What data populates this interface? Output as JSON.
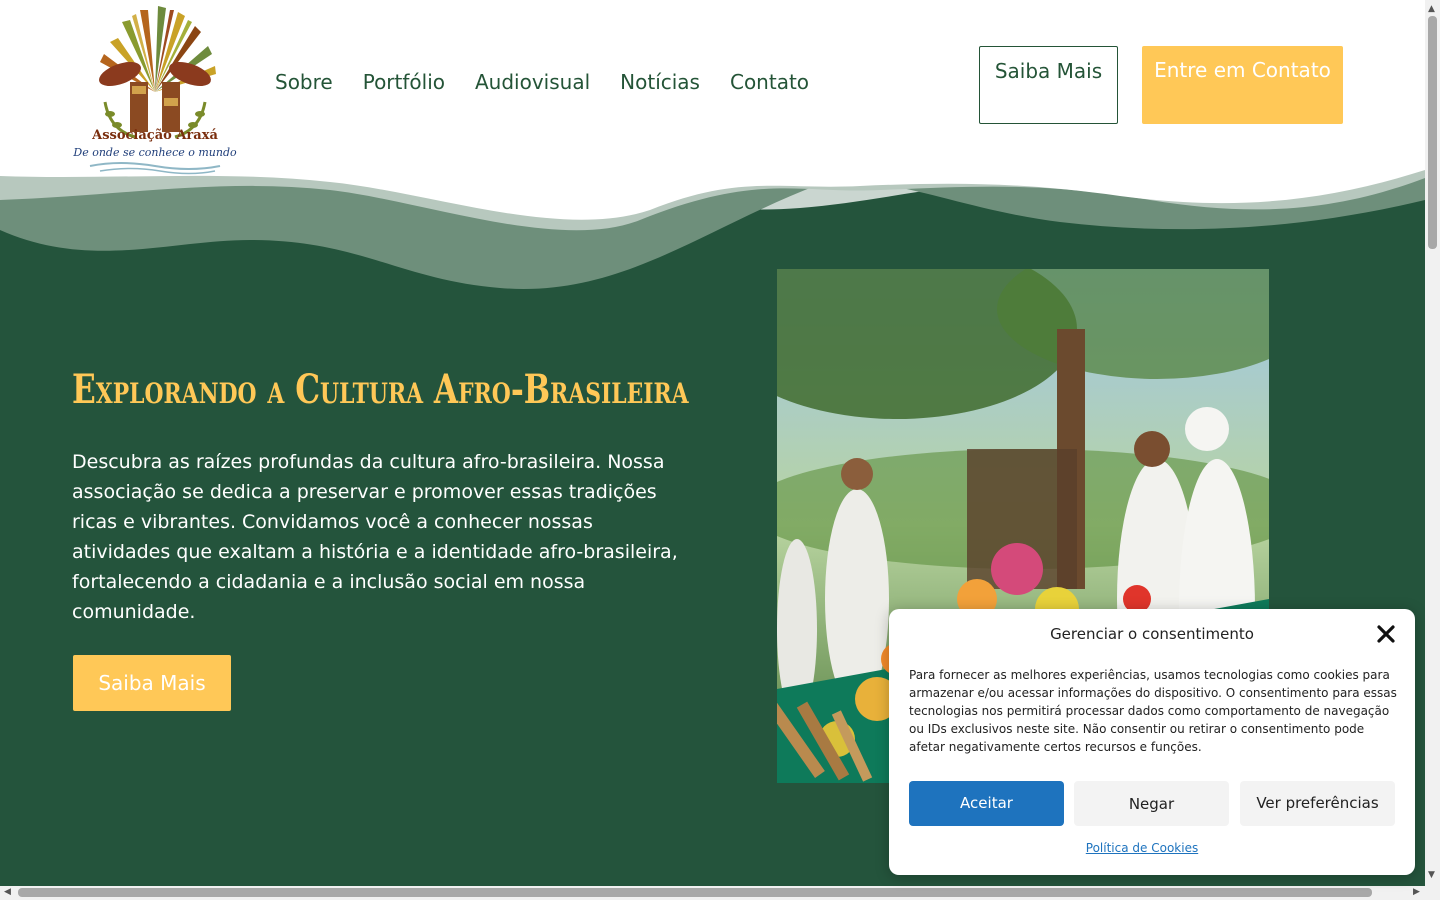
{
  "header": {
    "logo": {
      "org_name": "Associação Araxá",
      "tagline": "De onde se conhece o mundo"
    },
    "nav": [
      {
        "label": "Sobre"
      },
      {
        "label": "Portfólio"
      },
      {
        "label": "Audiovisual"
      },
      {
        "label": "Notícias"
      },
      {
        "label": "Contato"
      }
    ],
    "cta_outline": "Saiba Mais",
    "cta_primary": "Entre em Contato"
  },
  "hero": {
    "title": "Explorando a Cultura Afro-Brasileira",
    "text": "Descubra as raízes profundas da cultura afro-brasileira. Nossa associação se dedica a preservar e promover essas tradições ricas e vibrantes. Convidamos você a conhecer nossas atividades que exaltam a história e a identidade afro-brasileira, fortalecendo a cidadania e a inclusão social em nossa comunidade.",
    "button": "Saiba Mais"
  },
  "consent": {
    "title": "Gerenciar o consentimento",
    "text": "Para fornecer as melhores experiências, usamos tecnologias como cookies para armazenar e/ou acessar informações do dispositivo. O consentimento para essas tecnologias nos permitirá processar dados como comportamento de navegação ou IDs exclusivos neste site. Não consentir ou retirar o consentimento pode afetar negativamente certos recursos e funções.",
    "accept": "Aceitar",
    "deny": "Negar",
    "preferences": "Ver preferências",
    "policy_link": "Política de Cookies"
  },
  "colors": {
    "brand_green": "#24543C",
    "accent_yellow": "#FFC857",
    "accept_blue": "#1E73BE"
  },
  "icons": {
    "close": "close-icon"
  }
}
